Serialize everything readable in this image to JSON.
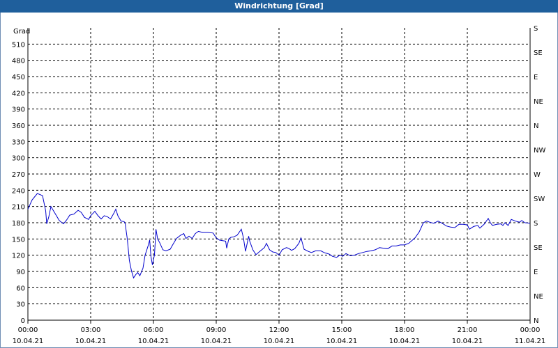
{
  "window": {
    "title": "Windrichtung [Grad]"
  },
  "chart_data": {
    "type": "line",
    "title": "Windrichtung [Grad]",
    "ylabel": "Grad",
    "ylim": [
      0,
      540
    ],
    "yticks": [
      0,
      30,
      60,
      90,
      120,
      150,
      180,
      210,
      240,
      270,
      300,
      330,
      360,
      390,
      420,
      450,
      480,
      510
    ],
    "right_axis_labels": [
      {
        "value": 0,
        "label": "N"
      },
      {
        "value": 45,
        "label": "NE"
      },
      {
        "value": 90,
        "label": "E"
      },
      {
        "value": 135,
        "label": "SE"
      },
      {
        "value": 180,
        "label": "S"
      },
      {
        "value": 225,
        "label": "SW"
      },
      {
        "value": 270,
        "label": "W"
      },
      {
        "value": 315,
        "label": "NW"
      },
      {
        "value": 360,
        "label": "N"
      },
      {
        "value": 405,
        "label": "NE"
      },
      {
        "value": 450,
        "label": "E"
      },
      {
        "value": 495,
        "label": "SE"
      },
      {
        "value": 540,
        "label": "S"
      }
    ],
    "xlim_hours": [
      0,
      24
    ],
    "xticks": [
      {
        "h": 0,
        "time": "00:00",
        "date": "10.04.21"
      },
      {
        "h": 3,
        "time": "03:00",
        "date": "10.04.21"
      },
      {
        "h": 6,
        "time": "06:00",
        "date": "10.04.21"
      },
      {
        "h": 9,
        "time": "09:00",
        "date": "10.04.21"
      },
      {
        "h": 12,
        "time": "12:00",
        "date": "10.04.21"
      },
      {
        "h": 15,
        "time": "15:00",
        "date": "10.04.21"
      },
      {
        "h": 18,
        "time": "18:00",
        "date": "10.04.21"
      },
      {
        "h": 21,
        "time": "21:00",
        "date": "10.04.21"
      },
      {
        "h": 24,
        "time": "00:00",
        "date": "11.04.21"
      }
    ],
    "grid": true,
    "line_color": "#0000cc",
    "series": [
      {
        "values": [
          [
            0.0,
            205
          ],
          [
            0.2,
            222
          ],
          [
            0.45,
            234
          ],
          [
            0.7,
            230
          ],
          [
            0.85,
            202
          ],
          [
            0.9,
            178
          ],
          [
            1.0,
            191
          ],
          [
            1.1,
            210
          ],
          [
            1.3,
            197
          ],
          [
            1.5,
            184
          ],
          [
            1.7,
            178
          ],
          [
            1.85,
            185
          ],
          [
            2.0,
            194
          ],
          [
            2.2,
            196
          ],
          [
            2.4,
            203
          ],
          [
            2.55,
            199
          ],
          [
            2.7,
            190
          ],
          [
            2.9,
            186
          ],
          [
            3.0,
            193
          ],
          [
            3.1,
            197
          ],
          [
            3.2,
            201
          ],
          [
            3.35,
            193
          ],
          [
            3.5,
            187
          ],
          [
            3.65,
            193
          ],
          [
            3.8,
            191
          ],
          [
            3.95,
            187
          ],
          [
            4.1,
            197
          ],
          [
            4.2,
            205
          ],
          [
            4.3,
            193
          ],
          [
            4.45,
            183
          ],
          [
            4.6,
            182
          ],
          [
            4.65,
            178
          ],
          [
            4.75,
            150
          ],
          [
            4.85,
            110
          ],
          [
            4.95,
            91
          ],
          [
            5.05,
            78
          ],
          [
            5.15,
            84
          ],
          [
            5.25,
            88
          ],
          [
            5.35,
            82
          ],
          [
            5.5,
            96
          ],
          [
            5.6,
            120
          ],
          [
            5.75,
            138
          ],
          [
            5.82,
            148
          ],
          [
            5.88,
            118
          ],
          [
            5.95,
            102
          ],
          [
            6.05,
            121
          ],
          [
            6.12,
            168
          ],
          [
            6.2,
            150
          ],
          [
            6.3,
            143
          ],
          [
            6.45,
            130
          ],
          [
            6.6,
            128
          ],
          [
            6.8,
            131
          ],
          [
            6.9,
            138
          ],
          [
            7.1,
            151
          ],
          [
            7.3,
            157
          ],
          [
            7.45,
            160
          ],
          [
            7.55,
            151
          ],
          [
            7.7,
            155
          ],
          [
            7.85,
            151
          ],
          [
            8.0,
            160
          ],
          [
            8.15,
            164
          ],
          [
            8.35,
            162
          ],
          [
            8.6,
            162
          ],
          [
            8.85,
            161
          ],
          [
            9.0,
            152
          ],
          [
            9.15,
            148
          ],
          [
            9.3,
            147
          ],
          [
            9.45,
            146
          ],
          [
            9.5,
            133
          ],
          [
            9.6,
            150
          ],
          [
            9.7,
            153
          ],
          [
            9.85,
            154
          ],
          [
            10.0,
            157
          ],
          [
            10.2,
            168
          ],
          [
            10.3,
            152
          ],
          [
            10.4,
            127
          ],
          [
            10.55,
            155
          ],
          [
            10.6,
            146
          ],
          [
            10.75,
            130
          ],
          [
            10.9,
            121
          ],
          [
            11.05,
            126
          ],
          [
            11.3,
            134
          ],
          [
            11.4,
            142
          ],
          [
            11.55,
            130
          ],
          [
            11.7,
            126
          ],
          [
            11.85,
            125
          ],
          [
            12.0,
            120
          ],
          [
            12.15,
            130
          ],
          [
            12.35,
            134
          ],
          [
            12.45,
            133
          ],
          [
            12.6,
            129
          ],
          [
            12.75,
            132
          ],
          [
            12.95,
            142
          ],
          [
            13.05,
            152
          ],
          [
            13.2,
            131
          ],
          [
            13.4,
            127
          ],
          [
            13.55,
            125
          ],
          [
            13.75,
            128
          ],
          [
            14.0,
            128
          ],
          [
            14.15,
            125
          ],
          [
            14.4,
            122
          ],
          [
            14.55,
            118
          ],
          [
            14.75,
            116
          ],
          [
            14.9,
            120
          ],
          [
            15.05,
            118
          ],
          [
            15.2,
            123
          ],
          [
            15.4,
            119
          ],
          [
            15.6,
            120
          ],
          [
            15.8,
            123
          ],
          [
            16.0,
            125
          ],
          [
            16.2,
            127
          ],
          [
            16.4,
            128
          ],
          [
            16.6,
            130
          ],
          [
            16.8,
            134
          ],
          [
            17.0,
            133
          ],
          [
            17.2,
            132
          ],
          [
            17.4,
            137
          ],
          [
            17.6,
            137
          ],
          [
            17.8,
            139
          ],
          [
            18.0,
            139
          ],
          [
            18.2,
            142
          ],
          [
            18.5,
            152
          ],
          [
            18.7,
            163
          ],
          [
            18.9,
            180
          ],
          [
            19.05,
            183
          ],
          [
            19.2,
            181
          ],
          [
            19.4,
            179
          ],
          [
            19.6,
            183
          ],
          [
            19.8,
            179
          ],
          [
            20.0,
            174
          ],
          [
            20.2,
            172
          ],
          [
            20.4,
            171
          ],
          [
            20.6,
            177
          ],
          [
            20.8,
            177
          ],
          [
            21.0,
            176
          ],
          [
            21.1,
            168
          ],
          [
            21.3,
            173
          ],
          [
            21.5,
            175
          ],
          [
            21.6,
            170
          ],
          [
            21.8,
            177
          ],
          [
            22.0,
            188
          ],
          [
            22.1,
            180
          ],
          [
            22.2,
            175
          ],
          [
            22.4,
            177
          ],
          [
            22.6,
            178
          ],
          [
            22.7,
            175
          ],
          [
            22.8,
            180
          ],
          [
            22.95,
            175
          ],
          [
            23.1,
            186
          ],
          [
            23.3,
            183
          ],
          [
            23.5,
            181
          ],
          [
            23.6,
            184
          ],
          [
            23.75,
            180
          ],
          [
            24.0,
            179
          ]
        ]
      }
    ]
  }
}
